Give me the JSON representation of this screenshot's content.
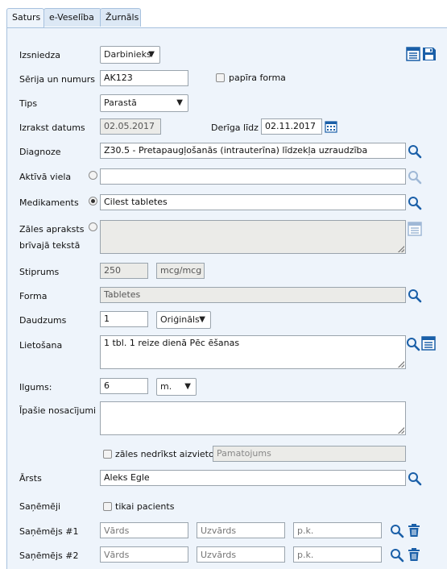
{
  "tabs": [
    "Saturs",
    "e-Veselība",
    "Žurnāls"
  ],
  "form": {
    "izsniedza": {
      "label": "Izsniedza",
      "value": "Darbinieks"
    },
    "serija": {
      "label": "Sērija un numurs",
      "value": "AK123",
      "paper_label": "papīra forma"
    },
    "tips": {
      "label": "Tips",
      "value": "Parastā"
    },
    "izrakst": {
      "label": "Izrakst datums",
      "value": "02.05.2017",
      "deriga_label": "Derīga līdz",
      "deriga_value": "02.11.2017"
    },
    "diagnoze": {
      "label": "Diagnoze",
      "value": "Z30.5 - Pretapaugļošanās (intrauterīna) līdzekļa uzraudzība"
    },
    "aktiva": {
      "label": "Aktīvā viela",
      "value": ""
    },
    "medikaments": {
      "label": "Medikaments",
      "value": "Cilest tabletes"
    },
    "zales": {
      "label_line1": "Zāles apraksts",
      "label_line2": "brīvajā tekstā",
      "value": ""
    },
    "stiprums": {
      "label": "Stiprums",
      "value": "250",
      "unit": "mcg/mcg"
    },
    "forma": {
      "label": "Forma",
      "value": "Tabletes"
    },
    "daudzums": {
      "label": "Daudzums",
      "value": "1",
      "pack": "Oriģināls"
    },
    "lietosana": {
      "label": "Lietošana",
      "value": "1 tbl. 1 reize dienā Pēc ēšanas"
    },
    "ilgums": {
      "label": "Ilgums:",
      "value": "6",
      "unit": "m."
    },
    "ipasie": {
      "label": "Īpašie nosacījumi",
      "value": ""
    },
    "nedrikst": {
      "label": "zāles nedrīkst aizvietot",
      "placeholder": "Pamatojums"
    },
    "arsts": {
      "label": "Ārsts",
      "value": "Aleks Egle"
    },
    "sanemeji": {
      "label": "Saņēmēji",
      "only_patient": "tikai pacients"
    },
    "receivers": [
      {
        "label": "Saņēmējs #1",
        "name_ph": "Vārds",
        "surname_ph": "Uzvārds",
        "pk_ph": "p.k."
      },
      {
        "label": "Saņēmējs #2",
        "name_ph": "Vārds",
        "surname_ph": "Uzvārds",
        "pk_ph": "p.k."
      }
    ]
  },
  "colors": {
    "accent": "#1a5fa8",
    "panel": "#eef4fb",
    "readonly": "#ebebe8"
  },
  "icons": [
    "search-icon",
    "list-icon",
    "save-icon",
    "calendar-icon",
    "trash-icon"
  ]
}
